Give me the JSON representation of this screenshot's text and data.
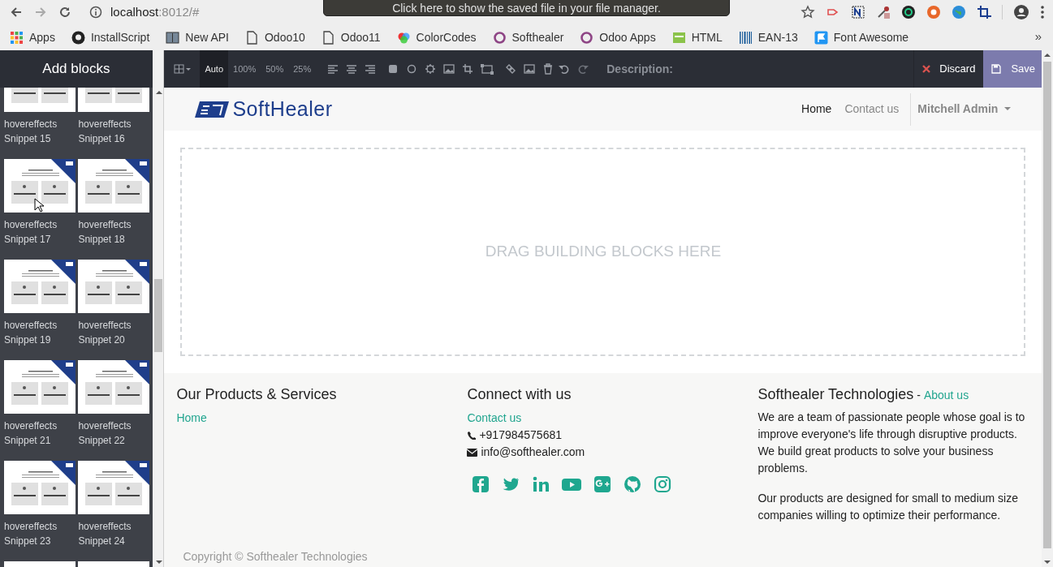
{
  "browser": {
    "url_host": "localhost",
    "url_rest": ":8012/#",
    "toast": "Click here to show the saved file in your file manager.",
    "bookmarks": [
      {
        "label": "Apps",
        "kind": "apps"
      },
      {
        "label": "InstallScript",
        "kind": "github"
      },
      {
        "label": "New API",
        "kind": "book"
      },
      {
        "label": "Odoo10",
        "kind": "page"
      },
      {
        "label": "Odoo11",
        "kind": "page"
      },
      {
        "label": "ColorCodes",
        "kind": "color"
      },
      {
        "label": "Softhealer",
        "kind": "ring"
      },
      {
        "label": "Odoo Apps",
        "kind": "ring"
      },
      {
        "label": "HTML",
        "kind": "html"
      },
      {
        "label": "EAN-13",
        "kind": "barcode"
      },
      {
        "label": "Font Awesome",
        "kind": "flag"
      }
    ],
    "more": "»"
  },
  "editor": {
    "sidebar_title": "Add blocks",
    "snippets": [
      {
        "label": "hovereffects Snippet 15",
        "kind": "plain"
      },
      {
        "label": "hovereffects Snippet 16",
        "kind": "plain"
      },
      {
        "label": "hovereffects Snippet 17",
        "kind": "badge"
      },
      {
        "label": "hovereffects Snippet 18",
        "kind": "badge"
      },
      {
        "label": "hovereffects Snippet 19",
        "kind": "badge"
      },
      {
        "label": "hovereffects Snippet 20",
        "kind": "badge"
      },
      {
        "label": "hovereffects Snippet 21",
        "kind": "badge"
      },
      {
        "label": "hovereffects Snippet 22",
        "kind": "badge"
      },
      {
        "label": "hovereffects Snippet 23",
        "kind": "badge"
      },
      {
        "label": "hovereffects Snippet 24",
        "kind": "badge"
      },
      {
        "kind": "cut"
      },
      {
        "kind": "cut"
      }
    ],
    "toolbar": [
      {
        "kind": "grid"
      },
      {
        "kind": "text",
        "label": "Auto",
        "selected": true
      },
      {
        "kind": "text",
        "label": "100%",
        "selected": false
      },
      {
        "kind": "text",
        "label": "50%",
        "selected": false
      },
      {
        "kind": "text",
        "label": "25%",
        "selected": false
      },
      {
        "kind": "align-left"
      },
      {
        "kind": "align-center"
      },
      {
        "kind": "align-right"
      },
      {
        "kind": "square"
      },
      {
        "kind": "circle"
      },
      {
        "kind": "gear"
      },
      {
        "kind": "image"
      },
      {
        "kind": "crop"
      },
      {
        "kind": "transform"
      },
      {
        "kind": "link"
      },
      {
        "kind": "image"
      },
      {
        "kind": "trash"
      },
      {
        "kind": "undo"
      },
      {
        "kind": "redo"
      }
    ],
    "description_label": "Description:",
    "discard": "Discard",
    "save": "Save"
  },
  "site": {
    "logo": "SoftHealer",
    "nav": [
      {
        "label": "Home",
        "selected": true
      },
      {
        "label": "Contact us",
        "selected": false
      }
    ],
    "user": "Mitchell Admin",
    "dropzone": "DRAG BUILDING BLOCKS HERE",
    "footer": {
      "products_title": "Our Products & Services",
      "products_links": [
        "Home"
      ],
      "connect_title": "Connect with us",
      "contact_link": "Contact us",
      "phone": "+917984575681",
      "email": "info@softhealer.com",
      "social": [
        {
          "kind": "facebook"
        },
        {
          "kind": "twitter"
        },
        {
          "kind": "linkedin"
        },
        {
          "kind": "youtube"
        },
        {
          "kind": "google-plus"
        },
        {
          "kind": "github"
        },
        {
          "kind": "instagram"
        }
      ],
      "company_title": "Softhealer Technologies",
      "company_sep": "-",
      "about_link": "About us",
      "paragraphs": [
        "We are a team of passionate people whose goal is to improve everyone's life through disruptive products. We build great products to solve your business problems.",
        "Our products are designed for small to medium size companies willing to optimize their performance."
      ],
      "copyright": "Copyright © Softhealer Technologies"
    }
  }
}
